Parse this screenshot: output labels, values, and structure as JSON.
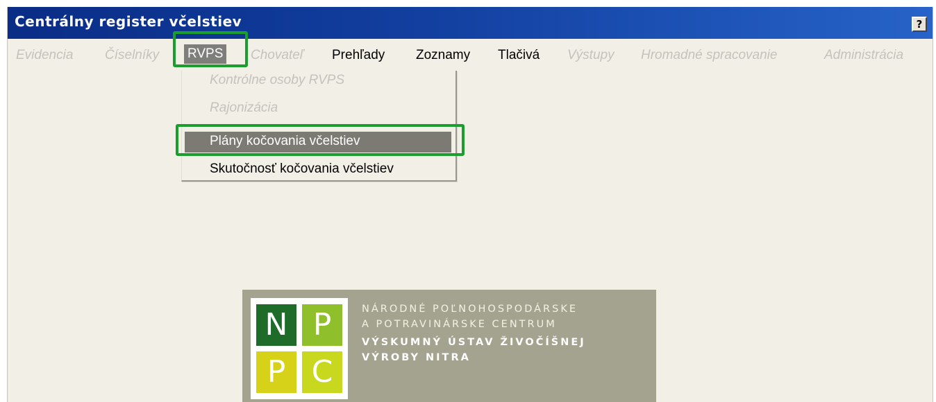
{
  "window": {
    "title": "Centrálny register včelstiev",
    "help_label": "?"
  },
  "menubar": {
    "items": [
      {
        "label": "Evidencia",
        "enabled": false
      },
      {
        "label": "Číselníky",
        "enabled": false
      },
      {
        "label": "RVPS",
        "enabled": true,
        "open": true
      },
      {
        "label": "Chovateľ",
        "enabled": false
      },
      {
        "label": "Prehľady",
        "enabled": true
      },
      {
        "label": "Zoznamy",
        "enabled": true
      },
      {
        "label": "Tlačivá",
        "enabled": true
      },
      {
        "label": "Výstupy",
        "enabled": false
      },
      {
        "label": "Hromadné spracovanie",
        "enabled": false
      },
      {
        "label": "Administrácia",
        "enabled": false
      }
    ]
  },
  "rvps_menu": {
    "items": [
      {
        "label": "Kontrólne osoby RVPS",
        "enabled": false
      },
      {
        "label": "Rajonizácia",
        "enabled": false
      },
      {
        "label": "Plány kočovania včelstiev",
        "enabled": true,
        "selected": true
      },
      {
        "label": "Skutočnosť kočovania včelstiev",
        "enabled": true
      }
    ]
  },
  "logo": {
    "letters": [
      "N",
      "P",
      "P",
      "C"
    ],
    "lines": [
      "NÁRODNÉ POĽNOHOSPODÁRSKE",
      "A POTRAVINÁRSKE CENTRUM",
      "VÝSKUMNÝ ÚSTAV ŽIVOČÍŠNEJ",
      "VÝROBY NITRA"
    ]
  },
  "colors": {
    "titlebar": "#123fa0",
    "highlight": "#1a9e2e",
    "logo_background": "#a4a38f",
    "logo_n": "#1f6b2a",
    "logo_p1": "#8fbf2a",
    "logo_p2": "#d6d21a",
    "logo_c": "#c8d81e"
  }
}
